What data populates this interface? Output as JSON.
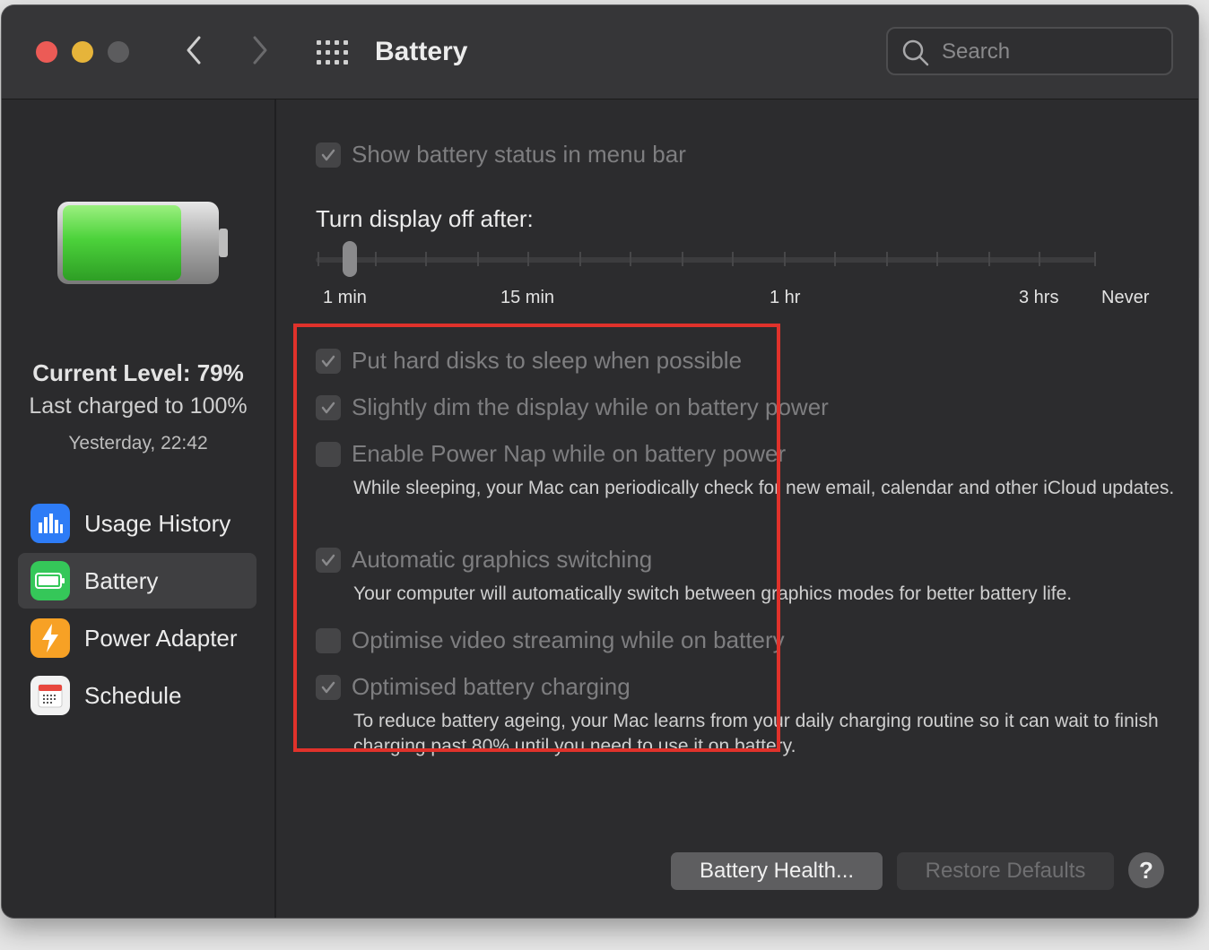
{
  "window": {
    "title": "Battery"
  },
  "search": {
    "placeholder": "Search"
  },
  "sidebar": {
    "current_level": "Current Level: 79%",
    "last_charged": "Last charged to 100%",
    "charged_time": "Yesterday, 22:42",
    "items": [
      {
        "label": "Usage History",
        "icon": "bar-chart-icon",
        "color": "#2e7cf6"
      },
      {
        "label": "Battery",
        "icon": "battery-icon",
        "color": "#35c759",
        "selected": true
      },
      {
        "label": "Power Adapter",
        "icon": "lightning-icon",
        "color": "#f7a125"
      },
      {
        "label": "Schedule",
        "icon": "calendar-icon",
        "color": "#f2f2f2"
      }
    ]
  },
  "options": {
    "show_status": {
      "label": "Show battery status in menu bar",
      "checked": true
    },
    "turn_display_off": "Turn display off after:",
    "slider_labels": [
      "1 min",
      "15 min",
      "1 hr",
      "3 hrs",
      "Never"
    ],
    "hard_disks": {
      "label": "Put hard disks to sleep when possible",
      "checked": true
    },
    "dim_display": {
      "label": "Slightly dim the display while on battery power",
      "checked": true
    },
    "power_nap": {
      "label": "Enable Power Nap while on battery power",
      "checked": false,
      "desc": "While sleeping, your Mac can periodically check for new email, calendar and other iCloud updates."
    },
    "graphics": {
      "label": "Automatic graphics switching",
      "checked": true,
      "desc": "Your computer will automatically switch between graphics modes for better battery life."
    },
    "video": {
      "label": "Optimise video streaming while on battery",
      "checked": false
    },
    "charging": {
      "label": "Optimised battery charging",
      "checked": true,
      "desc": "To reduce battery ageing, your Mac learns from your daily charging routine so it can wait to finish charging past 80% until you need to use it on battery."
    }
  },
  "buttons": {
    "health": "Battery Health...",
    "restore": "Restore Defaults",
    "help": "?"
  },
  "colors": {
    "highlight": "#e0322b",
    "battery_green": "#4cd23b"
  }
}
